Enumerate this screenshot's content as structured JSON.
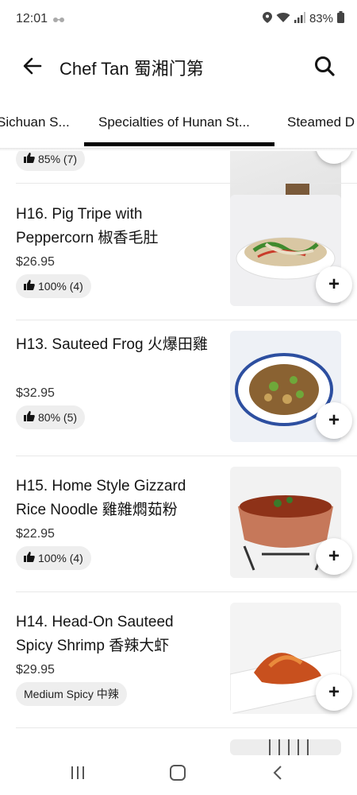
{
  "status": {
    "time": "12:01",
    "battery": "83%",
    "icons": [
      "glasses-icon",
      "location-icon",
      "wifi-icon",
      "signal-icon",
      "battery-icon"
    ]
  },
  "header": {
    "title": "Chef Tan 蜀湘门第",
    "back_icon": "back-arrow-icon",
    "search_icon": "search-icon"
  },
  "tabs": [
    {
      "label": "Sichuan S..."
    },
    {
      "label": "Specialties of Hunan St..."
    },
    {
      "label": "Steamed D"
    }
  ],
  "active_tab": 1,
  "items": [
    {
      "name": "",
      "price": "",
      "badge": "85% (7)",
      "badge_type": "rating"
    },
    {
      "name": "H16. Pig Tripe with Peppercorn 椒香毛肚",
      "price": "$26.95",
      "badge": "100% (4)",
      "badge_type": "rating"
    },
    {
      "name": "H13. Sauteed Frog 火爆田雞",
      "price": "$32.95",
      "badge": "80% (5)",
      "badge_type": "rating"
    },
    {
      "name": "H15. Home Style Gizzard Rice Noodle 雞雜燜茹粉",
      "price": "$22.95",
      "badge": "100% (4)",
      "badge_type": "rating"
    },
    {
      "name": "H14. Head-On Sauteed Spicy Shrimp 香辣大虾",
      "price": "$29.95",
      "badge": "Medium Spicy 中辣",
      "badge_type": "spice"
    }
  ],
  "add_label": "+",
  "colors": {
    "accent": "#000000",
    "badge_bg": "#eeeeee",
    "text": "#141414"
  }
}
